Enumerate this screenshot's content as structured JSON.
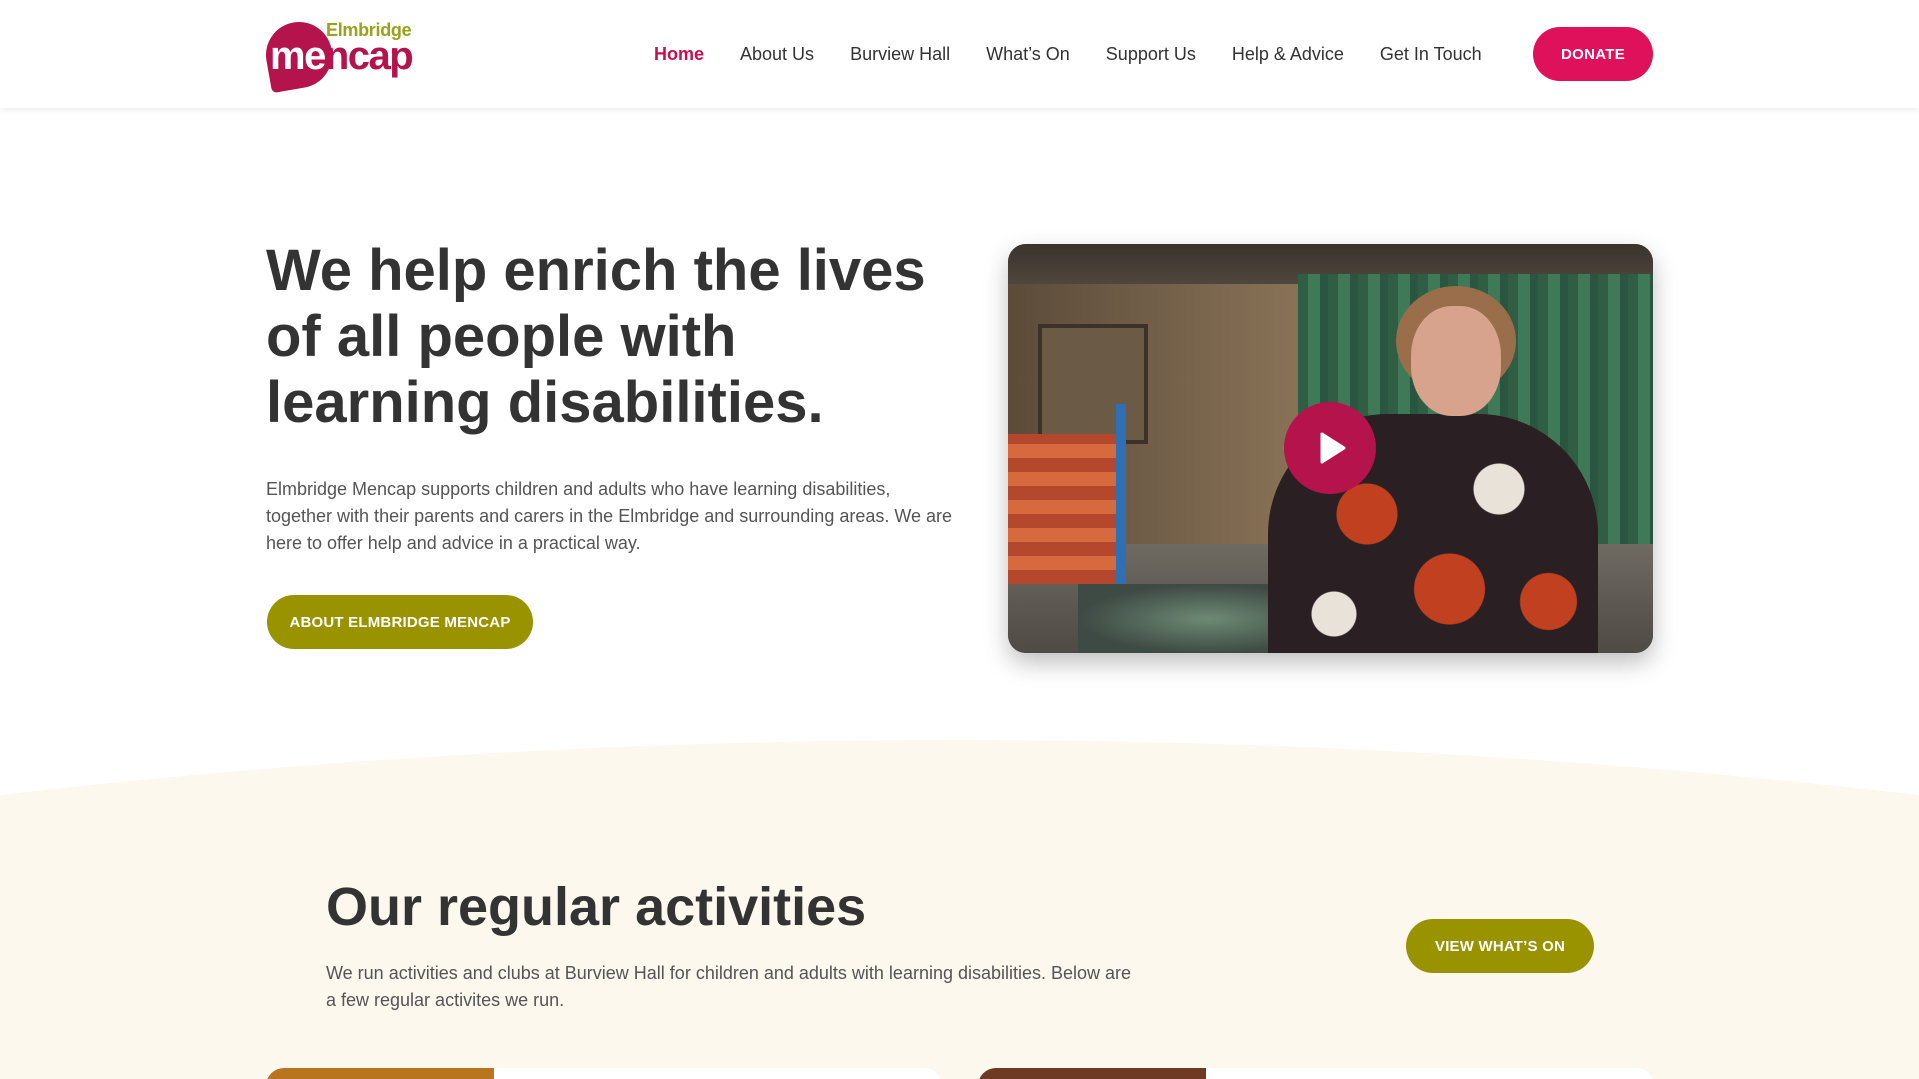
{
  "header": {
    "logo_top": "Elmbridge",
    "logo_main_a": "me",
    "logo_main_b": "ncap",
    "nav": [
      {
        "label": "Home",
        "active": true
      },
      {
        "label": "About Us"
      },
      {
        "label": "Burview Hall"
      },
      {
        "label": "What’s On"
      },
      {
        "label": "Support Us"
      },
      {
        "label": "Help & Advice"
      },
      {
        "label": "Get In Touch"
      }
    ],
    "donate_label": "DONATE"
  },
  "hero": {
    "title": "We help enrich the lives of all people with learning disabilities.",
    "text": "Elmbridge Mencap supports children and adults who have learning disabilities, together with their parents and carers in the Elmbridge and surrounding areas. We are here to offer help and advice in a practical way.",
    "button_label": "ABOUT ELMBRIDGE MENCAP",
    "video_icon": "play-icon"
  },
  "activities": {
    "title": "Our regular activities",
    "text": "We run activities and clubs at Burview Hall for children and adults with learning disabilities. Below are a few regular activites we run.",
    "button_label": "VIEW WHAT’S ON"
  },
  "colors": {
    "brand_magenta": "#b5134b",
    "donate_pink": "#e0115b",
    "olive": "#9a9300",
    "logo_green": "#9aa21b",
    "section_cream": "#fcf8ee"
  }
}
